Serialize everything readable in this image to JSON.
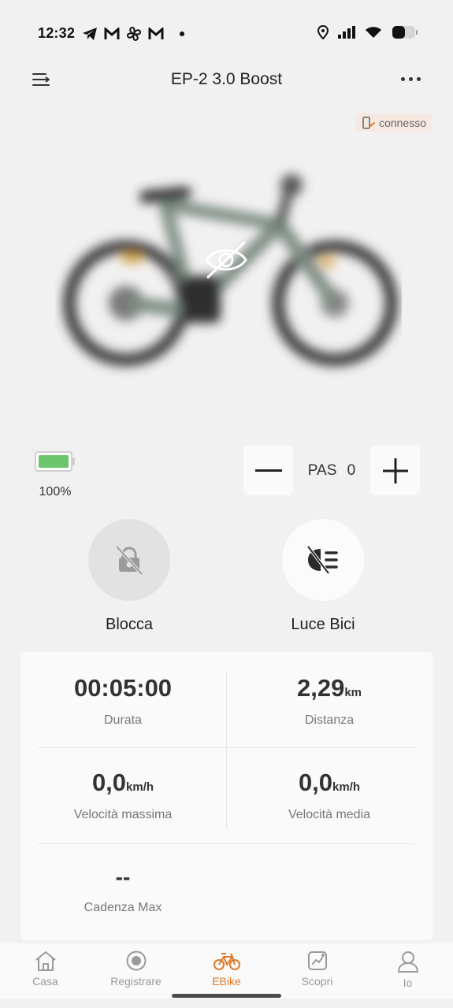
{
  "status_bar": {
    "time": "12:32"
  },
  "header": {
    "title": "EP-2 3.0 Boost"
  },
  "connection": {
    "status": "connesso"
  },
  "battery": {
    "level": 100,
    "label": "100%"
  },
  "pas": {
    "label": "PAS",
    "value": "0"
  },
  "actions": {
    "lock_label": "Blocca",
    "light_label": "Luce Bici"
  },
  "stats": {
    "duration_value": "00:05:00",
    "duration_label": "Durata",
    "distance_value": "2,29",
    "distance_unit": "km",
    "distance_label": "Distanza",
    "max_speed_value": "0,0",
    "max_speed_unit": "km/h",
    "max_speed_label": "Velocità massima",
    "avg_speed_value": "0,0",
    "avg_speed_unit": "km/h",
    "avg_speed_label": "Velocità media",
    "cadence_value": "--",
    "cadence_label": "Cadenza Max"
  },
  "nav": {
    "items": [
      {
        "label": "Casa",
        "icon": "home-icon"
      },
      {
        "label": "Registrare",
        "icon": "record-icon"
      },
      {
        "label": "EBike",
        "icon": "bike-icon"
      },
      {
        "label": "Scopri",
        "icon": "discover-icon"
      },
      {
        "label": "Io",
        "icon": "person-icon"
      }
    ],
    "active_index": 2
  },
  "colors": {
    "accent": "#e0782a",
    "battery_fill": "#6cc46c",
    "badge_bg": "#f6e9e2"
  }
}
